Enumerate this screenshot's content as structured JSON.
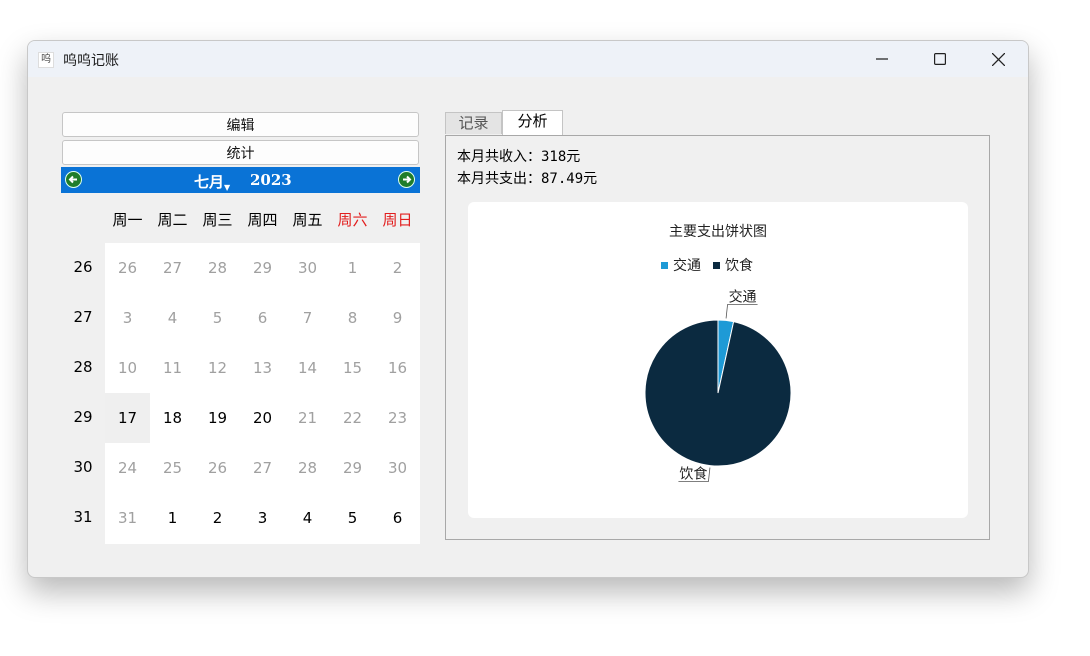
{
  "window": {
    "title": "呜呜记账",
    "icon_glyph": "呜",
    "controls": [
      "minimize",
      "maximize",
      "close"
    ]
  },
  "left": {
    "edit_label": "编辑",
    "stats_label": "统计"
  },
  "calendar": {
    "month": "七月",
    "year": "2023",
    "weekday_headers": [
      "周一",
      "周二",
      "周三",
      "周四",
      "周五",
      "周六",
      "周日"
    ],
    "week_numbers": [
      "26",
      "27",
      "28",
      "29",
      "30",
      "31"
    ],
    "selected_date": "17",
    "header_color": "#0a73d6",
    "weekend_color": "#e21d1d",
    "rows": [
      [
        "26",
        "27",
        "28",
        "29",
        "30",
        "1",
        "2"
      ],
      [
        "3",
        "4",
        "5",
        "6",
        "7",
        "8",
        "9"
      ],
      [
        "10",
        "11",
        "12",
        "13",
        "14",
        "15",
        "16"
      ],
      [
        "17",
        "18",
        "19",
        "20",
        "21",
        "22",
        "23"
      ],
      [
        "24",
        "25",
        "26",
        "27",
        "28",
        "29",
        "30"
      ],
      [
        "31",
        "1",
        "2",
        "3",
        "4",
        "5",
        "6"
      ]
    ],
    "muted": [
      [
        1,
        1,
        1,
        1,
        1,
        1,
        1
      ],
      [
        1,
        1,
        1,
        1,
        1,
        1,
        1
      ],
      [
        1,
        1,
        1,
        1,
        1,
        1,
        1
      ],
      [
        0,
        0,
        0,
        0,
        1,
        1,
        1
      ],
      [
        1,
        1,
        1,
        1,
        1,
        1,
        1
      ],
      [
        1,
        0,
        0,
        0,
        0,
        0,
        0
      ]
    ]
  },
  "tabs": [
    {
      "label": "记录",
      "active": false
    },
    {
      "label": "分析",
      "active": true
    }
  ],
  "analysis": {
    "income_text": "本月共收入：318元",
    "expense_text": "本月共支出：87.49元"
  },
  "chart_data": {
    "type": "pie",
    "title": "主要支出饼状图",
    "legend_position": "top",
    "slices": [
      {
        "label": "交通",
        "value": 3,
        "color": "#1e9ad6"
      },
      {
        "label": "饮食",
        "value": 84.49,
        "color": "#0b2a40"
      }
    ]
  }
}
